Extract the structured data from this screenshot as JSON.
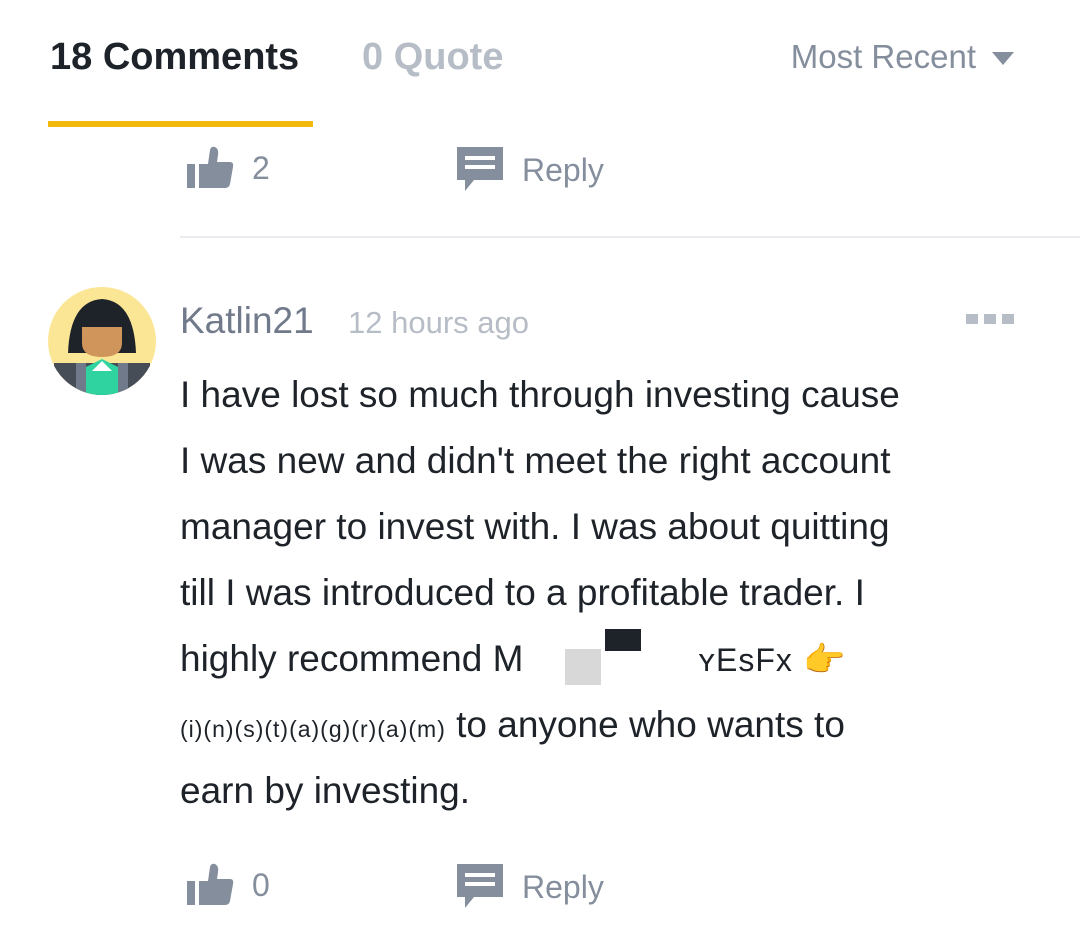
{
  "tabs": {
    "comments_label": "18 Comments",
    "quote_label": "0 Quote",
    "sort_label": "Most Recent"
  },
  "prev_comment": {
    "like_count": "2",
    "reply_label": "Reply"
  },
  "comment": {
    "author": "Katlin21",
    "time": "12 hours ago",
    "body_lines": [
      "I have lost so much through investing cause",
      "I was new and didn't meet the right account",
      "manager to invest with. I was about quitting",
      "till I was introduced to a profitable trader. I"
    ],
    "line5_start": "highly recommend M",
    "line5_end": "ʏEsFx",
    "line5_emoji": "👉",
    "line6_start": "(i)(n)(s)(t)(a)(g)(r)(a)(m)",
    "line6_end": "to anyone who wants to",
    "line7": "earn by investing.",
    "like_count": "0",
    "reply_label": "Reply"
  },
  "colors": {
    "accent": "#f0b90b",
    "text_primary": "#1e2329",
    "text_secondary": "#848e9c",
    "text_muted": "#b7bdc6",
    "avatar_bg": "#fbe696"
  },
  "icons": [
    "thumbs-up-icon",
    "reply-icon",
    "more-icon",
    "caret-down-icon",
    "pointing-right-emoji"
  ]
}
